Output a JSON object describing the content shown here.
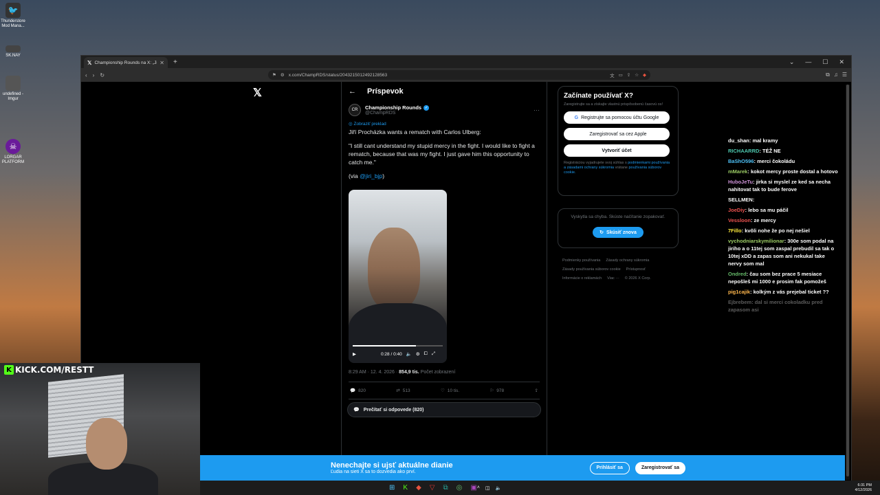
{
  "desktop": {
    "icons": [
      {
        "label": "Thunderstore Mod Mana...",
        "glyph": "🐦"
      },
      {
        "label": "SK.NAY",
        "glyph": "▬"
      },
      {
        "label": "undefined - Imgur",
        "glyph": "▤"
      },
      {
        "label": "LORGAR PLATFORM",
        "glyph": "☠"
      }
    ]
  },
  "browser": {
    "tab_title": "Championship Rounds na X: „Jiří...",
    "url": "x.com/ChampRDS/status/2043215012492128563"
  },
  "post": {
    "header": "Príspevok",
    "author_name": "Championship Rounds",
    "author_handle": "@ChampRDS",
    "avatar_text": "CR",
    "translate_label": "Zobraziť preklad",
    "line1": "Jiří Procházka wants a rematch with Carlos Ulberg:",
    "line2": "\"I still cant understand my stupid mercy in the fight. I would like to fight a rematch, because that was my fight. I just gave him this opportunity to catch me.\"",
    "via_prefix": "(via ",
    "via_mention": "@jiri_bjp",
    "via_suffix": ")",
    "video_time": "0:28 / 0:40",
    "video_progress": 0.7,
    "timestamp": "8:29 AM · 12. 4. 2026 · ",
    "views_value": "854,9 tis.",
    "views_label": " Počet zobrazení",
    "replies": "820",
    "reposts": "513",
    "likes": "10 tis.",
    "bookmarks": "978",
    "read_replies": "Prečítať si odpovede (820)"
  },
  "signup": {
    "title": "Začínate používať X?",
    "subtitle": "Zaregistrujte sa a získajte vlastnú prispôsobenú časovú os!",
    "google": "Registrujte sa pomocou účtu Google",
    "apple": "Zaregistrovať sa cez Apple",
    "create": "Vytvoriť účet",
    "legal_prefix": "Registráciou vyjadrujete svoj súhlas s ",
    "legal_link1": "podmienkami používania a zásadami ochrany súkromia",
    "legal_mid": " vrátane ",
    "legal_link2": "používania súborov cookie."
  },
  "error_card": {
    "message": "Vyskytla sa chyba. Skúste načítanie zopakovať.",
    "retry": "Skúsiť znova"
  },
  "footer_links": [
    "Podmienky používania",
    "Zásady ochrany súkromia",
    "Zásady používania súborov cookie",
    "Prístupnosť",
    "Informácie o reklamách",
    "Viac ···",
    "© 2026 X Corp."
  ],
  "banner": {
    "title": "Nenechajte si ujsť aktuálne dianie",
    "subtitle": "Ľudia na sieti X sa to dozvedia ako prví.",
    "login": "Prihlásiť sa",
    "signup": "Zaregistrovať sa"
  },
  "chat": [
    {
      "user": "du_shan",
      "color": "#ffffff",
      "text": "mal kramy"
    },
    {
      "user": "RICHAARRD",
      "color": "#4ec9b0",
      "text": "TÉŽ NE"
    },
    {
      "user": "BaShO596",
      "color": "#4fc3f7",
      "text": "merci čokoládu"
    },
    {
      "user": "mMarek",
      "color": "#9ccc65",
      "text": "kokot mercy proste dostal a hotovo"
    },
    {
      "user": "HuboJeTu",
      "color": "#ce93d8",
      "text": "jirka si myslel ze ked sa necha nahitovat tak to bude ferove"
    },
    {
      "user": "SELLMEN",
      "color": "#ffffff",
      "text": ""
    },
    {
      "user": "JoeDiy",
      "color": "#ef5350",
      "text": "lebo sa mu páčil"
    },
    {
      "user": "Vessloon",
      "color": "#ef5350",
      "text": "ze mercy"
    },
    {
      "user": "7Fillo",
      "color": "#ffeb3b",
      "text": "kvôli nohe že po nej nešiel"
    },
    {
      "user": "vychodniarskymilionar",
      "color": "#9ccc65",
      "text": "300e som podal na jiriho a o 11tej som zaspal prebudil sa tak o 10tej xDD a zapas som ani nekukal take nervy som mal"
    },
    {
      "user": "Ondred",
      "color": "#66bb6a",
      "text": "čau som bez prace 5 mesiace nepošleš mi 1000 e prosim fak pomožeš"
    },
    {
      "user": "pig1cajik",
      "color": "#ffb74d",
      "text": "kolkým z vás prejebal ticket ??"
    },
    {
      "user": "Ejbrebem",
      "color": "#ffffff",
      "text": "dal si merci cokoladku pred zapasom asi"
    }
  ],
  "webcam": {
    "kick_label": "KICK.COM/RESTT"
  },
  "taskbar": {
    "time": "6:31 PM",
    "date": "4/12/2026"
  }
}
